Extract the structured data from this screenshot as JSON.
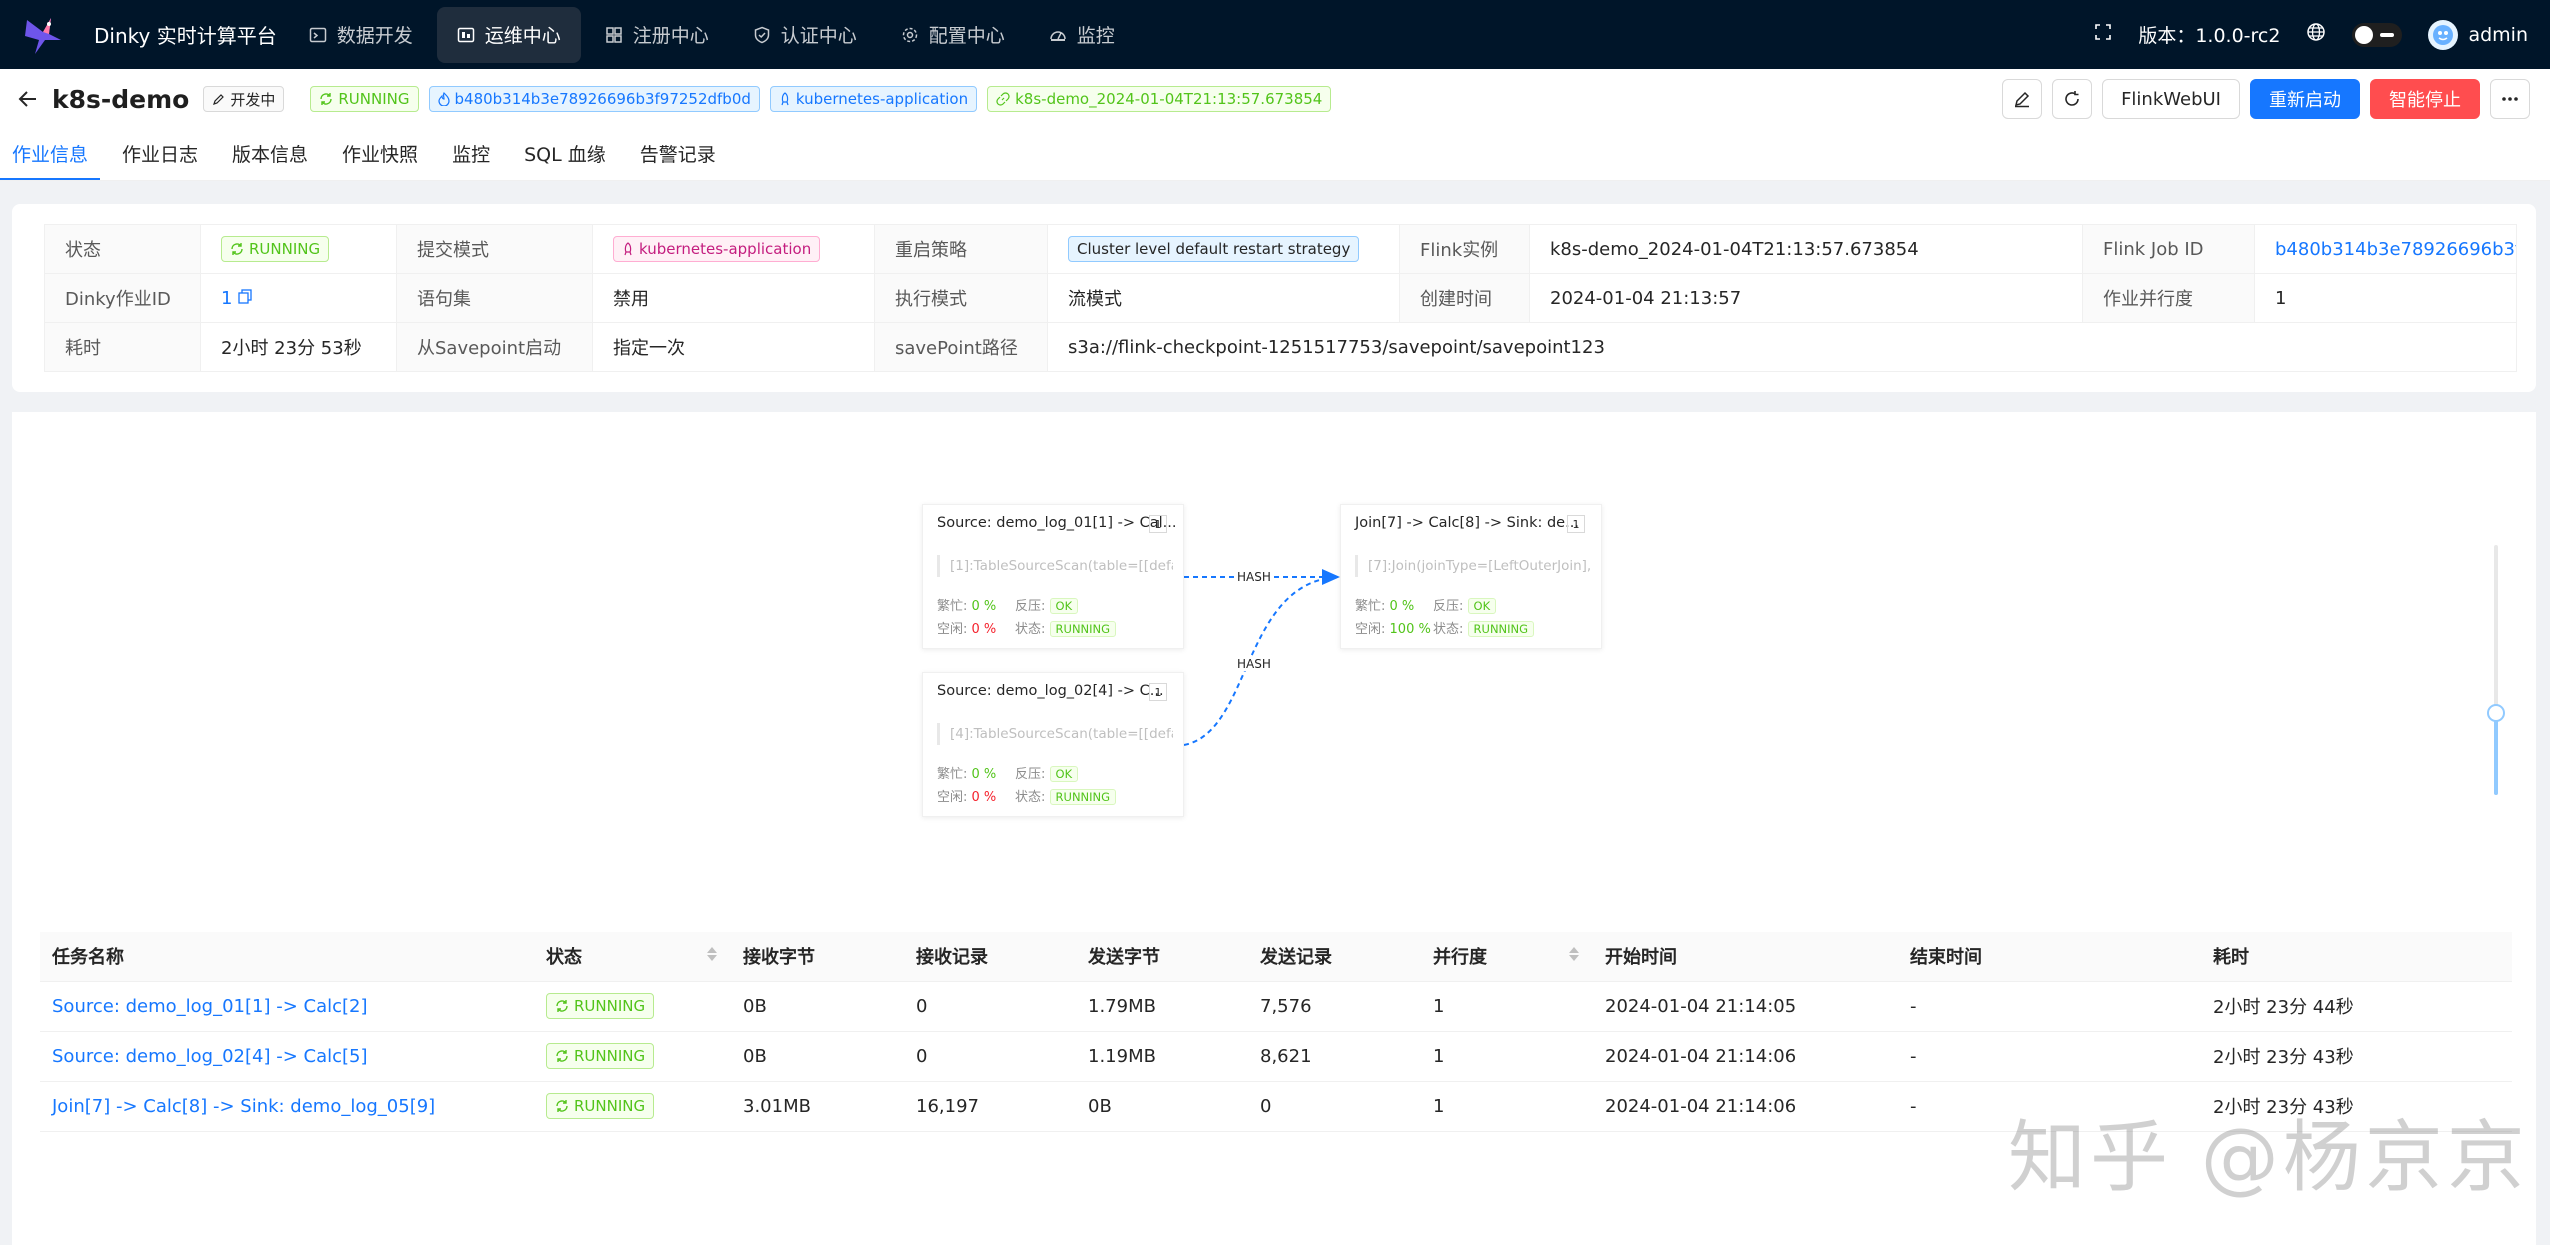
{
  "app": {
    "brand": "Dinky 实时计算平台",
    "nav": [
      "数据开发",
      "运维中心",
      "注册中心",
      "认证中心",
      "配置中心",
      "监控"
    ],
    "version_label": "版本：1.0.0-rc2",
    "user": "admin"
  },
  "job": {
    "name": "k8s-demo",
    "dev_tag": "开发中",
    "status": "RUNNING",
    "job_id_tag": "b480b314b3e78926696b3f97252dfb0d",
    "mode_tag": "kubernetes-application",
    "instance_tag": "k8s-demo_2024-01-04T21:13:57.673854"
  },
  "actions": {
    "flink_webui": "FlinkWebUI",
    "restart": "重新启动",
    "smart_stop": "智能停止"
  },
  "tabs": [
    "作业信息",
    "作业日志",
    "版本信息",
    "作业快照",
    "监控",
    "SQL 血缘",
    "告警记录"
  ],
  "info": {
    "row1": {
      "status_label": "状态",
      "status_value": "RUNNING",
      "submit_mode_label": "提交模式",
      "submit_mode_value": "kubernetes-application",
      "restart_label": "重启策略",
      "restart_value": "Cluster level default restart strategy",
      "instance_label": "Flink实例",
      "instance_value": "k8s-demo_2024-01-04T21:13:57.673854",
      "jobid_label": "Flink Job ID",
      "jobid_value": "b480b314b3e78926696b3f97252dfb0d"
    },
    "row2": {
      "dinky_id_label": "Dinky作业ID",
      "dinky_id_value": "1",
      "stmtset_label": "语句集",
      "stmtset_value": "禁用",
      "exec_mode_label": "执行模式",
      "exec_mode_value": "流模式",
      "created_label": "创建时间",
      "created_value": "2024-01-04 21:13:57",
      "parallel_label": "作业并行度",
      "parallel_value": "1"
    },
    "row3": {
      "duration_label": "耗时",
      "duration_value": "2小时 23分 53秒",
      "savepoint_start_label": "从Savepoint启动",
      "savepoint_start_value": "指定一次",
      "savepoint_path_label": "savePoint路径",
      "savepoint_path_value": "s3a://flink-checkpoint-1251517753/savepoint/savepoint123"
    }
  },
  "graph": {
    "nodes": [
      {
        "title": "Source: demo_log_01[1] -> Cal...",
        "parallel": "1",
        "desc": "[1]:TableSourceScan(table=[[defaul",
        "busy_label": "繁忙:",
        "busy": "0 %",
        "bp_label": "反压:",
        "bp": "OK",
        "idle_label": "空闲:",
        "idle": "0 %",
        "state_label": "状态:",
        "state": "RUNNING"
      },
      {
        "title": "Source: demo_log_02[4] -> C...",
        "parallel": "1",
        "desc": "[4]:TableSourceScan(table=[[defaul",
        "busy_label": "繁忙:",
        "busy": "0 %",
        "bp_label": "反压:",
        "bp": "OK",
        "idle_label": "空闲:",
        "idle": "0 %",
        "state_label": "状态:",
        "state": "RUNNING"
      },
      {
        "title": "Join[7] -> Calc[8] -> Sink: de...",
        "parallel": "1",
        "desc": "[7]:Join(joinType=[LeftOuterJoin], w",
        "busy_label": "繁忙:",
        "busy": "0 %",
        "bp_label": "反压:",
        "bp": "OK",
        "idle_label": "空闲:",
        "idle": "100 %",
        "state_label": "状态:",
        "state": "RUNNING"
      }
    ],
    "edge_labels": [
      "HASH",
      "HASH"
    ]
  },
  "table": {
    "columns": [
      "任务名称",
      "状态",
      "接收字节",
      "接收记录",
      "发送字节",
      "发送记录",
      "并行度",
      "开始时间",
      "结束时间",
      "耗时"
    ],
    "rows": [
      {
        "name": "Source: demo_log_01[1] -> Calc[2]",
        "status": "RUNNING",
        "recv_bytes": "0B",
        "recv_records": "0",
        "send_bytes": "1.79MB",
        "send_records": "7,576",
        "parallelism": "1",
        "start": "2024-01-04 21:14:05",
        "end": "-",
        "duration": "2小时 23分 44秒"
      },
      {
        "name": "Source: demo_log_02[4] -> Calc[5]",
        "status": "RUNNING",
        "recv_bytes": "0B",
        "recv_records": "0",
        "send_bytes": "1.19MB",
        "send_records": "8,621",
        "parallelism": "1",
        "start": "2024-01-04 21:14:06",
        "end": "-",
        "duration": "2小时 23分 43秒"
      },
      {
        "name": "Join[7] -> Calc[8] -> Sink: demo_log_05[9]",
        "status": "RUNNING",
        "recv_bytes": "3.01MB",
        "recv_records": "16,197",
        "send_bytes": "0B",
        "send_records": "0",
        "parallelism": "1",
        "start": "2024-01-04 21:14:06",
        "end": "-",
        "duration": "2小时 23分 43秒"
      }
    ]
  },
  "watermark": "知乎 @杨京京",
  "colors": {
    "primary": "#1677ff",
    "danger": "#ff4d4f",
    "success": "#52c41a",
    "topbar": "#001529"
  }
}
